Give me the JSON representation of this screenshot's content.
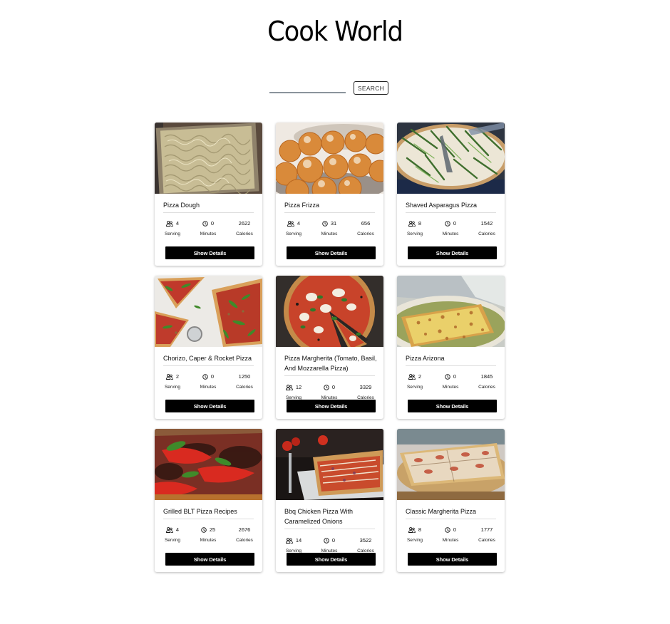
{
  "app": {
    "title": "Cook World"
  },
  "search": {
    "value": "",
    "placeholder": "",
    "button_label": "SEARCH"
  },
  "labels": {
    "serving": "Serving",
    "minutes": "Minutes",
    "calories": "Calories",
    "show_details": "Show Details"
  },
  "recipes": [
    {
      "name": "Pizza Dough",
      "serving": "4",
      "minutes": "0",
      "calories": "2622",
      "image": "pizza-dough-photo"
    },
    {
      "name": "Pizza Frizza",
      "serving": "4",
      "minutes": "31",
      "calories": "656",
      "image": "fried-dough-balls-photo"
    },
    {
      "name": "Shaved Asparagus Pizza",
      "serving": "8",
      "minutes": "0",
      "calories": "1542",
      "image": "asparagus-pizza-photo"
    },
    {
      "name": "Chorizo, Caper & Rocket Pizza",
      "serving": "2",
      "minutes": "0",
      "calories": "1250",
      "image": "chorizo-rocket-pizza-photo"
    },
    {
      "name": "Pizza Margherita (Tomato, Basil, And Mozzarella Pizza)",
      "serving": "12",
      "minutes": "0",
      "calories": "3329",
      "image": "margherita-pizza-photo"
    },
    {
      "name": "Pizza Arizona",
      "serving": "2",
      "minutes": "0",
      "calories": "1845",
      "image": "arizona-pizza-photo"
    },
    {
      "name": "Grilled BLT Pizza Recipes",
      "serving": "4",
      "minutes": "25",
      "calories": "2676",
      "image": "blt-pizza-photo"
    },
    {
      "name": "Bbq Chicken Pizza With Caramelized Onions",
      "serving": "14",
      "minutes": "0",
      "calories": "3522",
      "image": "bbq-chicken-pizza-photo"
    },
    {
      "name": "Classic Margherita Pizza",
      "serving": "8",
      "minutes": "0",
      "calories": "1777",
      "image": "classic-margherita-photo"
    }
  ]
}
